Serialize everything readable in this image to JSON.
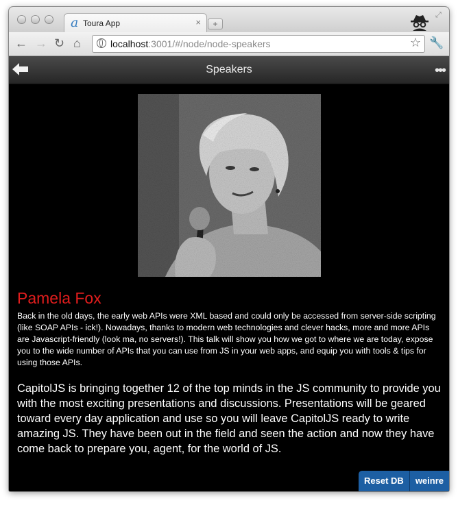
{
  "browser": {
    "tab_title": "Toura App",
    "tab_close": "×",
    "new_tab": "+",
    "url_host": "localhost",
    "url_path": ":3001/#/node/node-speakers"
  },
  "app": {
    "title": "Speakers",
    "menu_icon": "•••"
  },
  "speaker": {
    "name": "Pamela Fox",
    "bio": "Back in the old days, the early web APIs were XML based and could only be accessed from server-side scripting (like SOAP APIs - ick!). Nowadays, thanks to modern web technologies and clever hacks, more and more APIs are Javascript-friendly (look ma, no servers!). This talk will show you how we got to where we are today, expose you to the wide number of APIs that you can use from JS in your web apps, and equip you with tools & tips for using those APIs."
  },
  "event_description": "CapitolJS is bringing together 12 of the top minds in the JS community to provide you with the most exciting presentations and discussions. Presentations will be geared toward every day application and use so you will leave CapitolJS ready to write amazing JS. They have been out in the field and seen the action and now they have come back to prepare you, agent, for the world of JS.",
  "dev_buttons": {
    "reset_db": "Reset DB",
    "weinre": "weinre"
  },
  "icons": {
    "favicon": "a",
    "back": "back-arrow-icon",
    "forward": "forward-arrow-icon",
    "reload": "reload-icon",
    "home": "home-icon",
    "site_info": "globe-icon",
    "bookmark": "star-icon",
    "settings": "wrench-icon",
    "incognito": "incognito-icon"
  },
  "colors": {
    "speaker_name": "#e11d1d",
    "dev_button": "#1d5fa3",
    "app_background": "#000000"
  }
}
